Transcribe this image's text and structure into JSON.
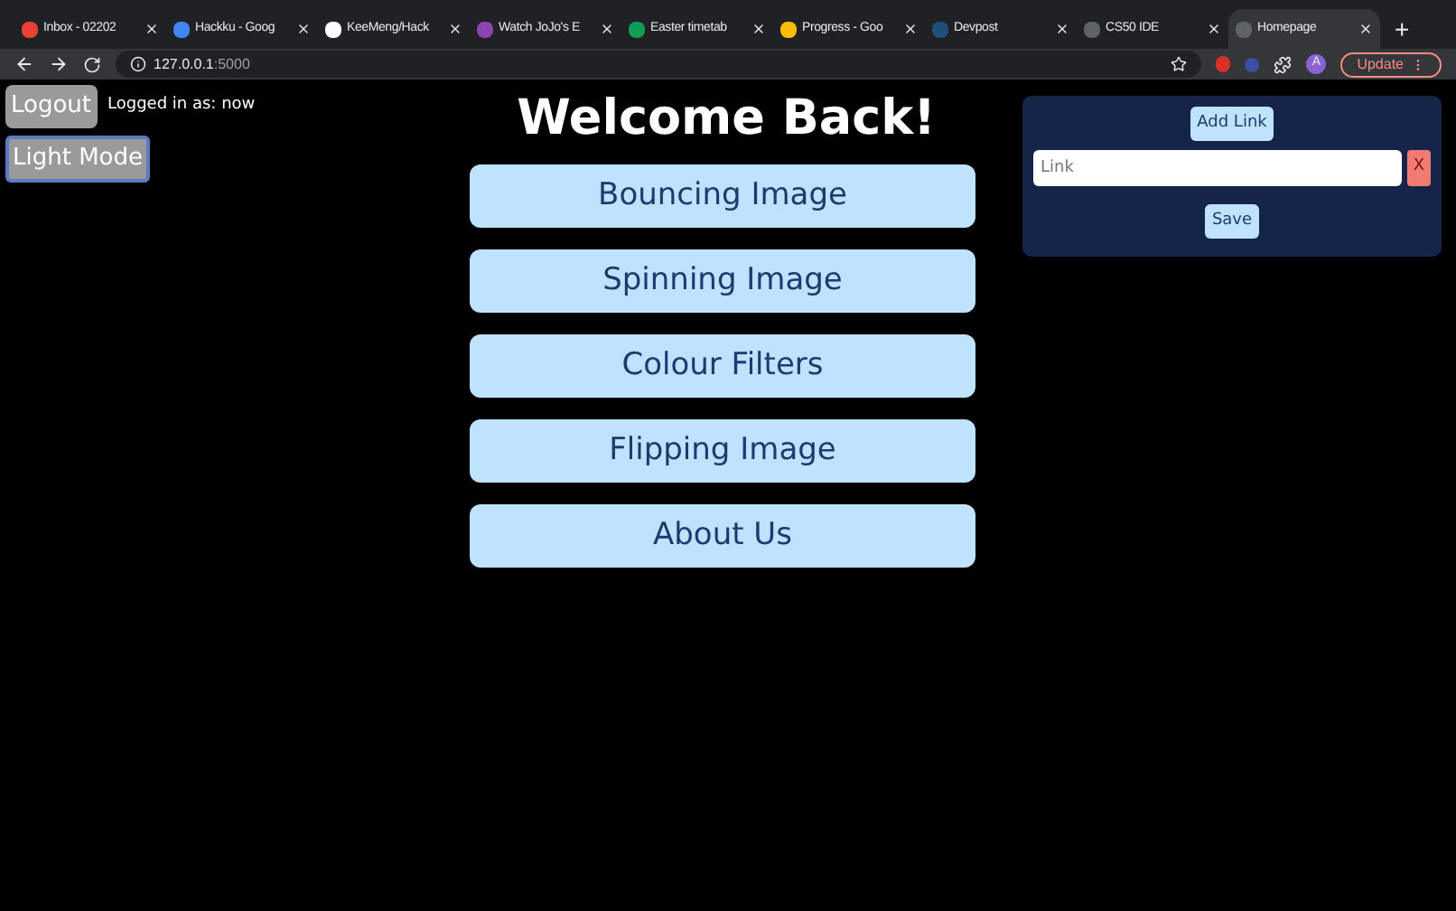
{
  "browser": {
    "tabs": [
      {
        "title": "Inbox - 02202",
        "color": "#ea4335",
        "selected": false
      },
      {
        "title": "Hackku - Goog",
        "color": "#4285f4",
        "selected": false
      },
      {
        "title": "KeeMeng/Hack",
        "color": "#ffffff",
        "selected": false
      },
      {
        "title": "Watch JoJo's E",
        "color": "#8e44ad",
        "selected": false
      },
      {
        "title": "Easter timetab",
        "color": "#0f9d58",
        "selected": false
      },
      {
        "title": "Progress - Goo",
        "color": "#fbbc04",
        "selected": false
      },
      {
        "title": "Devpost",
        "color": "#1f4e79",
        "selected": false
      },
      {
        "title": "CS50 IDE",
        "color": "#5f6368",
        "selected": false
      },
      {
        "title": "Homepage",
        "color": "#5f6368",
        "selected": true
      }
    ],
    "new_tab": "+",
    "address": {
      "host": "127.0.0.1",
      "port": ":5000"
    },
    "avatar": "A",
    "update_button": "Update"
  },
  "page": {
    "logout_button": "Logout",
    "logged_in_text": "Logged in as: now",
    "mode_button": "Light Mode",
    "heading": "Welcome Back!",
    "nav_buttons": [
      "Bouncing Image",
      "Spinning Image",
      "Colour Filters",
      "Flipping Image",
      "About Us"
    ],
    "links_panel": {
      "add_button": "Add Link",
      "link_placeholder": "Link",
      "remove_button": "X",
      "save_button": "Save"
    }
  }
}
